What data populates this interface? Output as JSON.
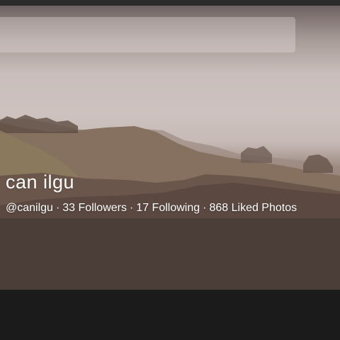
{
  "search": {
    "placeholder": ""
  },
  "profile": {
    "name": "can ilgu",
    "handle": "@canilgu",
    "followers": "33 Followers",
    "following": "17 Following",
    "liked_photos": "868 Liked Photos",
    "separator": "·"
  },
  "colors": {
    "page_background": "#1a1a1a",
    "text": "#ffffff"
  }
}
